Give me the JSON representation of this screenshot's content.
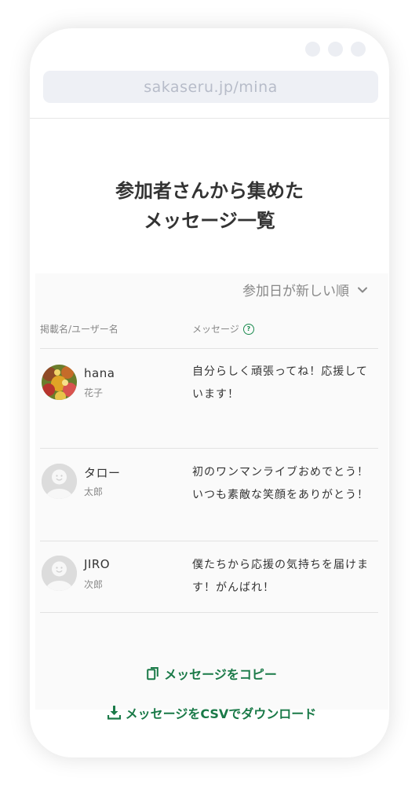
{
  "browser": {
    "url": "sakaseru.jp/mina"
  },
  "page": {
    "title_line1": "参加者さんから集めた",
    "title_line2": "メッセージ一覧"
  },
  "list": {
    "sort_label": "参加日が新しい順",
    "header_user": "掲載名/ユーザー名",
    "header_message": "メッセージ",
    "rows": [
      {
        "display_name": "hana",
        "user_name": "花子",
        "message": "自分らしく頑張ってね！応援しています！",
        "avatar": "flower-photo"
      },
      {
        "display_name": "タロー",
        "user_name": "太郎",
        "message": "初のワンマンライブおめでとう！いつも素敵な笑顔をありがとう！",
        "avatar": "default-face"
      },
      {
        "display_name": "JIRO",
        "user_name": "次郎",
        "message": "僕たちから応援の気持ちを届けます！がんばれ！",
        "avatar": "default-face"
      }
    ]
  },
  "actions": {
    "copy_label": "メッセージをコピー",
    "csv_label": "メッセージをCSVでダウンロード"
  },
  "colors": {
    "accent": "#1a7a48",
    "text": "#333333",
    "muted": "#888888",
    "url_bg": "#eef0f5"
  }
}
